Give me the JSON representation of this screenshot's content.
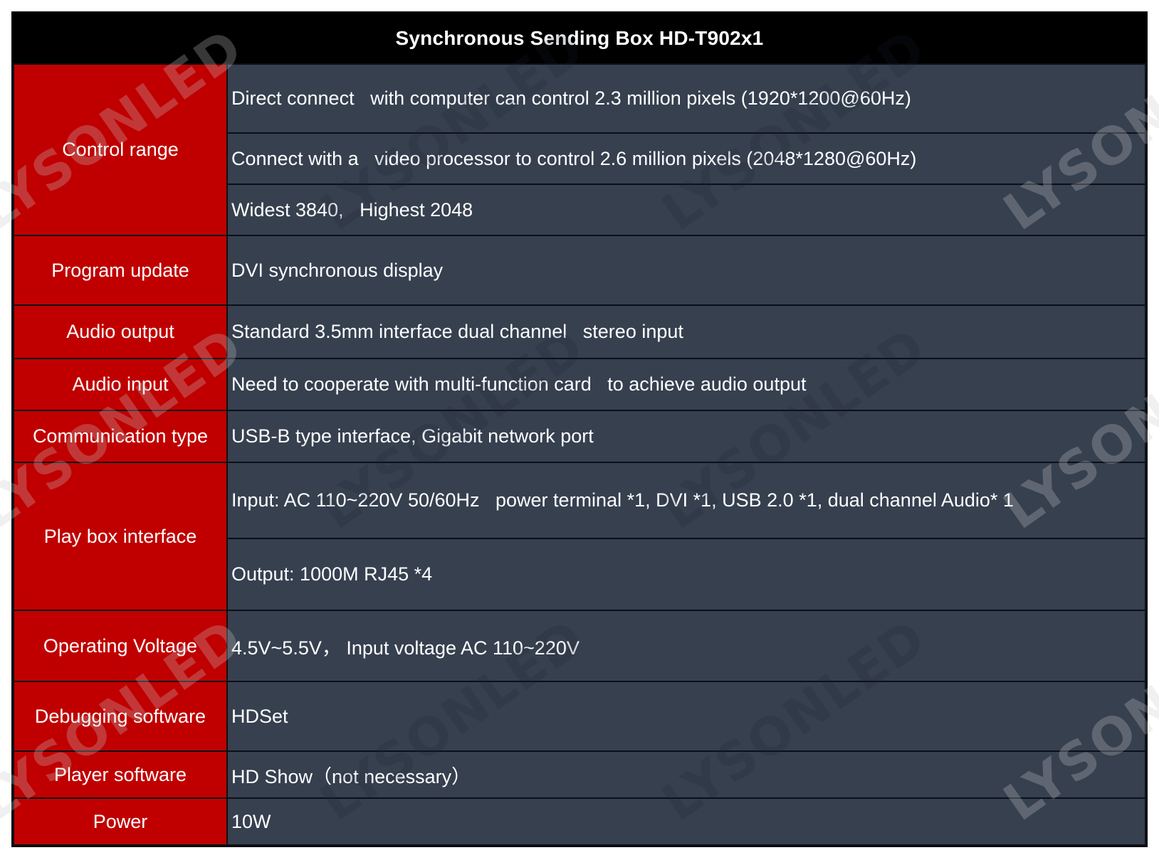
{
  "title": "Synchronous Sending Box HD-T902x1",
  "colors": {
    "header_bg": "#000000",
    "label_bg": "#c00000",
    "value_bg": "#36404f",
    "text": "#ffffff"
  },
  "watermark": "LYSONLED",
  "rows": [
    {
      "label": "Control range",
      "values": [
        "Direct connect   with computer can control 2.3 million pixels (1920*1200@60Hz)",
        "Connect with a   video processor to control 2.6 million pixels (2048*1280@60Hz)",
        "Widest 3840,   Highest 2048"
      ]
    },
    {
      "label": "Program update",
      "values": [
        "DVI synchronous display"
      ]
    },
    {
      "label": "Audio output",
      "values": [
        "Standard 3.5mm interface dual channel   stereo input"
      ]
    },
    {
      "label": "Audio input",
      "values": [
        "Need to cooperate with multi-function card   to achieve audio output"
      ]
    },
    {
      "label": "Communication type",
      "values": [
        "USB-B type interface, Gigabit network port"
      ]
    },
    {
      "label": "Play box interface",
      "values": [
        "Input: AC 110~220V 50/60Hz   power terminal *1, DVI *1, USB 2.0 *1, dual channel Audio* 1",
        "Output: 1000M RJ45 *4"
      ]
    },
    {
      "label": "Operating Voltage",
      "values": [
        "4.5V~5.5V， Input voltage AC 110~220V"
      ]
    },
    {
      "label": "Debugging software",
      "values": [
        "HDSet"
      ]
    },
    {
      "label": "Player software",
      "values": [
        "HD Show（not necessary）"
      ]
    },
    {
      "label": "Power",
      "values": [
        "10W"
      ]
    }
  ]
}
